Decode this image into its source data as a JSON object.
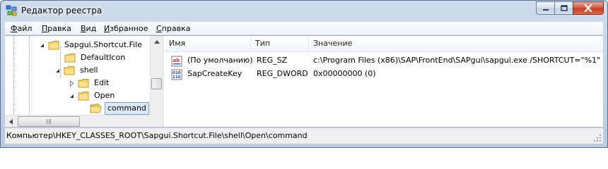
{
  "window": {
    "title": "Редактор реестра"
  },
  "menu": {
    "items": [
      {
        "first": "Ф",
        "rest": "айл"
      },
      {
        "first": "П",
        "rest": "равка"
      },
      {
        "first": "В",
        "rest": "ид"
      },
      {
        "first": "И",
        "rest": "збранное"
      },
      {
        "first": "С",
        "rest": "правка"
      }
    ]
  },
  "tree": {
    "nodes": [
      {
        "label": "Sapgui.Shortcut.File",
        "icon": "folder-icon",
        "expanded": true
      },
      {
        "label": "DefaultIcon",
        "icon": "folder-icon",
        "expanded": false
      },
      {
        "label": "shell",
        "icon": "folder-icon",
        "expanded": true
      },
      {
        "label": "Edit",
        "icon": "folder-icon",
        "expanded": false
      },
      {
        "label": "Open",
        "icon": "folder-icon",
        "expanded": true
      },
      {
        "label": "command",
        "icon": "folder-open-icon",
        "selected": true
      }
    ]
  },
  "list": {
    "columns": [
      "Имя",
      "Тип",
      "Значение"
    ],
    "rows": [
      {
        "icon": "string-value-icon",
        "name": "(По умолчанию)",
        "type": "REG_SZ",
        "value": "c:\\Program Files (x86)\\SAP\\FrontEnd\\SAPgui\\sapgui.exe /SHORTCUT=\"%1\""
      },
      {
        "icon": "binary-value-icon",
        "name": "SapCreateKey",
        "type": "REG_DWORD",
        "value": "0x00000000 (0)"
      }
    ]
  },
  "status": {
    "path": "Компьютер\\HKEY_CLASSES_ROOT\\Sapgui.Shortcut.File\\shell\\Open\\command"
  }
}
